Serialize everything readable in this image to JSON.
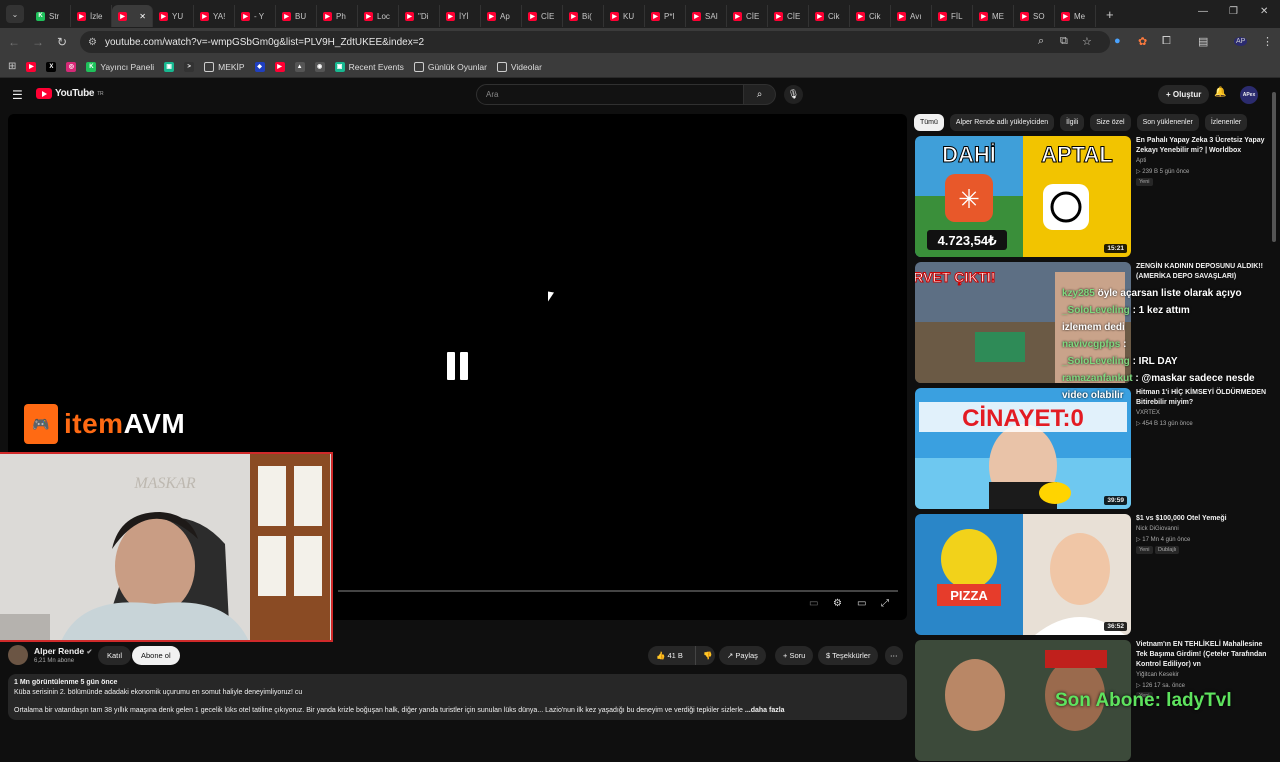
{
  "browser": {
    "tabs": [
      {
        "label": "Str",
        "color": "#1ec15a",
        "glyph": "K"
      },
      {
        "label": "İzle",
        "color": "#ff0033",
        "glyph": ""
      },
      {
        "label": "",
        "color": "#ff0033",
        "glyph": "",
        "active": true
      },
      {
        "label": "YU",
        "color": "#ff0033",
        "glyph": ""
      },
      {
        "label": "YA!",
        "color": "#ff0033",
        "glyph": ""
      },
      {
        "label": "- Y",
        "color": "#ff0033",
        "glyph": ""
      },
      {
        "label": "BU",
        "color": "#ff0033",
        "glyph": ""
      },
      {
        "label": "Ph",
        "color": "#ff0033",
        "glyph": ""
      },
      {
        "label": "Loc",
        "color": "#ff0033",
        "glyph": ""
      },
      {
        "label": "\"Di",
        "color": "#ff0033",
        "glyph": ""
      },
      {
        "label": "İYİ",
        "color": "#ff0033",
        "glyph": ""
      },
      {
        "label": "Ap",
        "color": "#ff0033",
        "glyph": ""
      },
      {
        "label": "CİE",
        "color": "#ff0033",
        "glyph": ""
      },
      {
        "label": "Bi(",
        "color": "#ff0033",
        "glyph": ""
      },
      {
        "label": "KU",
        "color": "#ff0033",
        "glyph": ""
      },
      {
        "label": "P*I",
        "color": "#ff0033",
        "glyph": ""
      },
      {
        "label": "SAI",
        "color": "#ff0033",
        "glyph": ""
      },
      {
        "label": "CİE",
        "color": "#ff0033",
        "glyph": ""
      },
      {
        "label": "CİE",
        "color": "#ff0033",
        "glyph": ""
      },
      {
        "label": "Cik",
        "color": "#ff0033",
        "glyph": ""
      },
      {
        "label": "Cik",
        "color": "#ff0033",
        "glyph": ""
      },
      {
        "label": "Avı",
        "color": "#ff0033",
        "glyph": ""
      },
      {
        "label": "FİL",
        "color": "#ff0033",
        "glyph": ""
      },
      {
        "label": "ME",
        "color": "#ff0033",
        "glyph": ""
      },
      {
        "label": "SO",
        "color": "#ff0033",
        "glyph": ""
      },
      {
        "label": "Me",
        "color": "#ff0033",
        "glyph": ""
      }
    ],
    "new_tab": "+",
    "url": "youtube.com/watch?v=-wmpGSbGm0g&list=PLV9H_ZdtUKEE&index=2",
    "bookmarks": [
      {
        "label": "",
        "color": "#ff0033",
        "glyph": "▶",
        "kind": "yt"
      },
      {
        "label": "",
        "color": "#000000",
        "glyph": "X",
        "kind": "x"
      },
      {
        "label": "",
        "color": "#d62976",
        "glyph": "◎",
        "kind": "ig"
      },
      {
        "label": "Yayıncı Paneli",
        "color": "#1ec15a",
        "glyph": "K",
        "kind": "kick"
      },
      {
        "label": "",
        "color": "#17b890",
        "glyph": "▣",
        "kind": "app"
      },
      {
        "label": "",
        "color": "#333333",
        "glyph": ">",
        "kind": "term"
      },
      {
        "label": "MEKİP",
        "color": "#3b3b3b",
        "glyph": "▭",
        "kind": "folder"
      },
      {
        "label": "",
        "color": "#1f3fbf",
        "glyph": "◆",
        "kind": "app"
      },
      {
        "label": "",
        "color": "#ff0033",
        "glyph": "▶",
        "kind": "yt"
      },
      {
        "label": "",
        "color": "#555555",
        "glyph": "▲",
        "kind": "img"
      },
      {
        "label": "",
        "color": "#555555",
        "glyph": "◉",
        "kind": "ai"
      },
      {
        "label": "Recent Events",
        "color": "#17b890",
        "glyph": "▣",
        "kind": "app"
      },
      {
        "label": "Günlük Oyunlar",
        "color": "#3b3b3b",
        "glyph": "▭",
        "kind": "folder"
      },
      {
        "label": "Videolar",
        "color": "#3b3b3b",
        "glyph": "▭",
        "kind": "folder"
      }
    ]
  },
  "youtube": {
    "logo_text": "YouTube",
    "logo_sup": "TR",
    "search_placeholder": "Ara",
    "create_label": "+ Oluştur",
    "avatar_text": "APex"
  },
  "overlays": {
    "sponsor_item": "item",
    "sponsor_avm": "AVM",
    "webcam_sign": "MASKAR",
    "last_sub": "Son Abone: ladyTvl",
    "chat": [
      {
        "user": "kzy285",
        "text": "öyle açarsan liste olarak açıyo"
      },
      {
        "user": "_SoloLeveling",
        "text": ": 1 kez attım"
      },
      {
        "user": "",
        "text": "izlemem dedi"
      },
      {
        "user": "navivcgpfps",
        "text": ":"
      },
      {
        "user": "_SoloLeveling",
        "text": ": IRL DAY"
      },
      {
        "user": "ramazanfankut",
        "text": ": @maskar sadece nesde"
      },
      {
        "user": "",
        "text": "video olabilir"
      }
    ]
  },
  "channel": {
    "name": "Alper Rende",
    "subs": "6,21 Mn abone",
    "join": "Katıl",
    "subscribe": "Abone ol",
    "likes": "41 B",
    "share": "Paylaş",
    "ask": "Soru",
    "thanks": "Teşekkürler",
    "more": "⋯"
  },
  "description": {
    "meta": "1 Mn görüntülenme  5 gün önce",
    "line1": "Küba serisinin 2. bölümünde adadaki ekonomik uçurumu en somut haliyle deneyimliyoruz! cu",
    "line2": "Ortalama bir vatandaşın tam 38 yıllık maaşına denk gelen 1 gecelik lüks otel tatiline çıkıyoruz. Bir yanda krizle boğuşan halk, diğer yanda turistler için sunulan lüks dünya... Lazio'nun ilk kez yaşadığı bu deneyim ve verdiği tepkiler sizlerle",
    "more": "...daha fazla"
  },
  "rail": {
    "chips": [
      "Tümü",
      "Alper Rende adlı yükleyiciden",
      "İlgili",
      "Size özel",
      "Son yüklenenler",
      "İzlenenler"
    ],
    "videos": [
      {
        "title": "En Pahalı Yapay Zeka 3 Ücretsiz Yapay Zekayı Yenebilir mi? | Worldbox",
        "channel": "Apti",
        "meta": "▷ 239 B  5 gün önce",
        "badge": "Yeni",
        "duration": "15:21",
        "t1": "DAHİ",
        "t2": "APTAL",
        "price": "4.723,54₺"
      },
      {
        "title": "ZENGİN KADININ DEPOSUNU ALDIK!! (AMERİKA DEPO SAVAŞLARI)",
        "channel": "",
        "meta": "",
        "badge": "",
        "duration": "",
        "t1": "SERVET ÇIKTI!"
      },
      {
        "title": "Hitman 1'i HİÇ KİMSEYİ ÖLDÜRMEDEN Bitirebilir miyim?",
        "channel": "VXRTEX",
        "meta": "▷ 454 B  13 gün önce",
        "badge": "",
        "duration": "39:59",
        "t1": "CİNAYET:0"
      },
      {
        "title": "$1 vs $100,000 Otel Yemeği",
        "channel": "Nick DiGiovanni",
        "meta": "▷ 17 Mn  4 gün önce",
        "badge": "Yeni",
        "badge2": "Dublajlı",
        "duration": "36:52",
        "t1": "PIZZA"
      },
      {
        "title": "Vietnam'ın EN TEHLİKELİ Mahallesine Tek Başıma Girdim! (Çeteler Tarafından Kontrol Ediliyor) vn",
        "channel": "Yiğitcan Kesekir",
        "meta": "▷ 126  17 sa. önce",
        "badge": "Yeni",
        "duration": ""
      }
    ]
  }
}
